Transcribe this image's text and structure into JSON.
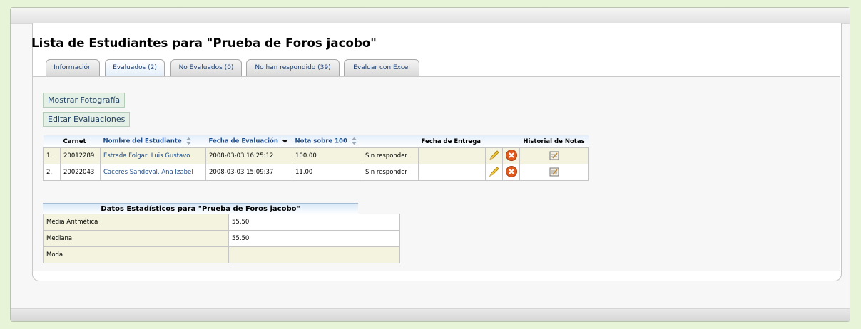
{
  "page": {
    "title": "Lista de Estudiantes para \"Prueba de Foros jacobo\""
  },
  "tabs": [
    {
      "label": "Información",
      "active": false
    },
    {
      "label": "Evaluados (2)",
      "active": true
    },
    {
      "label": "No Evaluados (0)",
      "active": false
    },
    {
      "label": "No han respondido (39)",
      "active": false
    },
    {
      "label": "Evaluar con Excel",
      "active": false
    }
  ],
  "buttons": {
    "show_photo": "Mostrar Fotografía",
    "edit_evaluations": "Editar Evaluaciones"
  },
  "table": {
    "headers": {
      "carnet": "Carnet",
      "name": "Nombre del Estudiante",
      "eval_date": "Fecha de Evaluación",
      "grade": "Nota sobre 100",
      "delivery_date": "Fecha de Entrega",
      "history": "Historial de Notas"
    },
    "rows": [
      {
        "num": "1.",
        "carnet": "20012289",
        "name": "Estrada Folgar, Luis Gustavo",
        "eval_date": "2008-03-03 16:25:12",
        "grade": "100.00",
        "status": "Sin responder",
        "delivery_date": ""
      },
      {
        "num": "2.",
        "carnet": "20022043",
        "name": "Caceres Sandoval, Ana Izabel",
        "eval_date": "2008-03-03 15:09:37",
        "grade": "11.00",
        "status": "Sin responder",
        "delivery_date": ""
      }
    ]
  },
  "stats": {
    "title": "Datos Estadísticos para \"Prueba de Foros jacobo\"",
    "rows": [
      {
        "label": "Media Aritmética",
        "value": "55.50"
      },
      {
        "label": "Mediana",
        "value": "55.50"
      },
      {
        "label": "Moda",
        "value": ""
      }
    ]
  },
  "icons": {
    "edit": "pencil-icon",
    "delete": "delete-icon",
    "history": "notepad-icon",
    "sort_both": "sort-both-icon",
    "sort_desc": "sort-desc-icon"
  },
  "colors": {
    "link": "#1a4a8a",
    "row_highlight": "#f3f3df",
    "button_bg": "#e4efe6",
    "delete_icon": "#e05a1e"
  }
}
